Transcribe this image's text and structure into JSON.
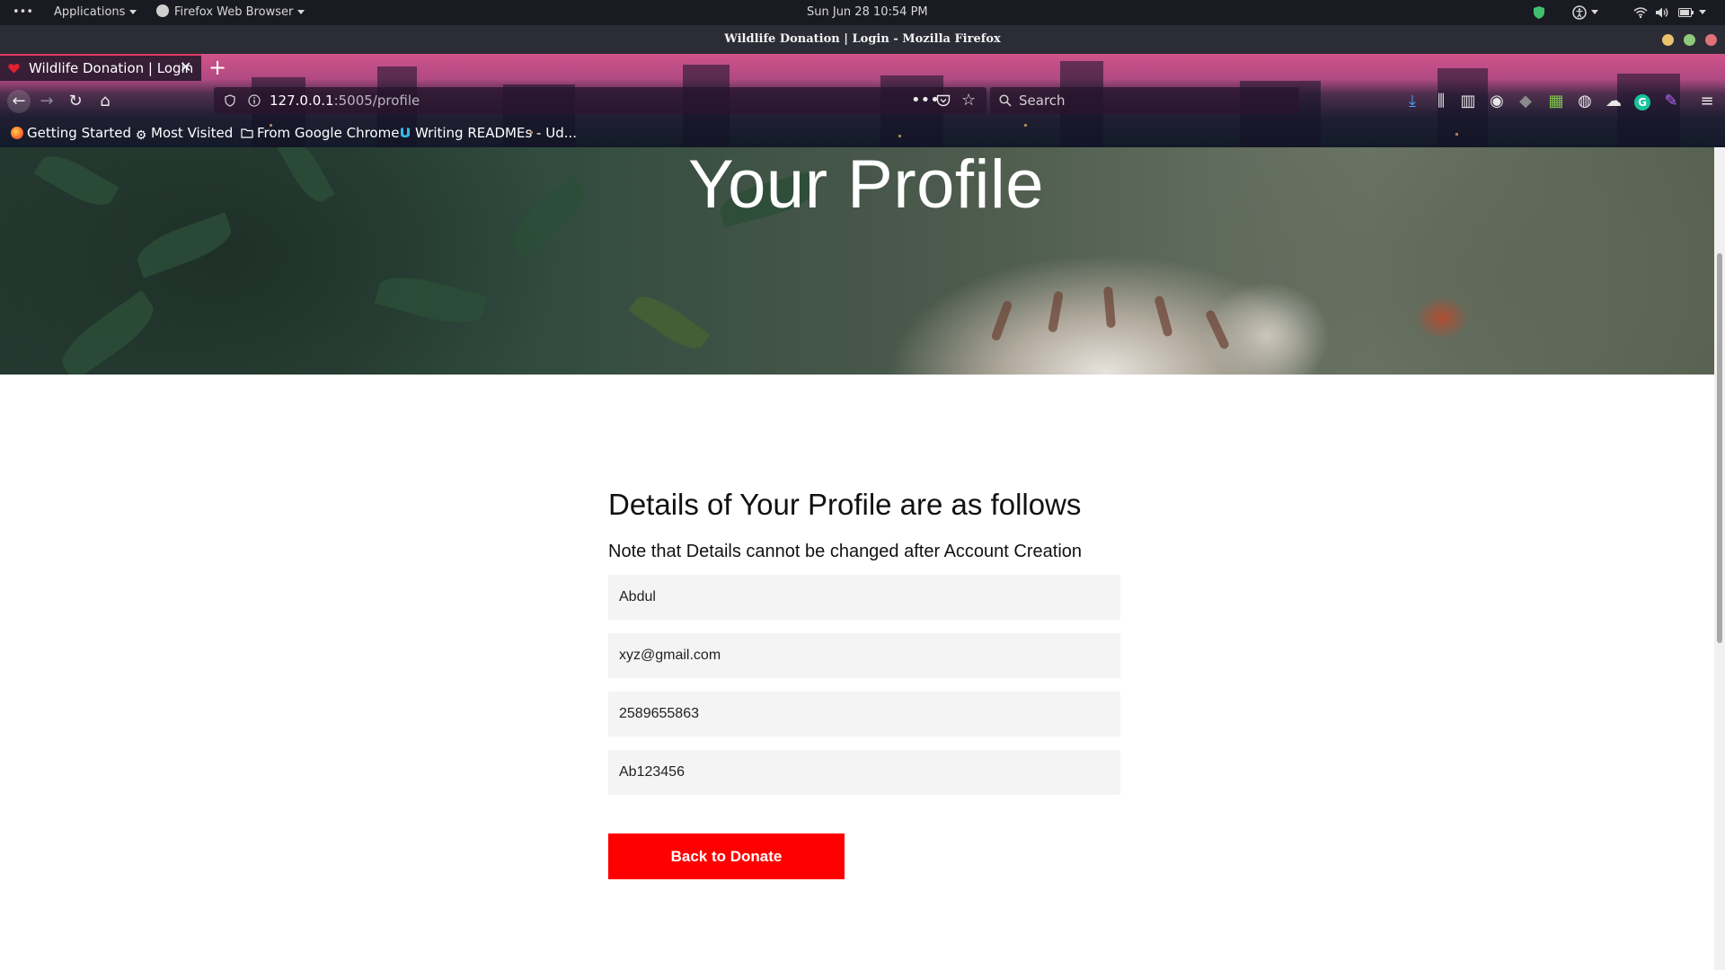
{
  "system_bar": {
    "dots": "•••",
    "applications": "Applications",
    "app_name": "Firefox Web Browser",
    "clock": "Sun Jun 28  10:54 PM"
  },
  "window": {
    "title": "Wildlife Donation | Login - Mozilla Firefox"
  },
  "tabs": [
    {
      "label": "Wildlife Donation | Login",
      "active": true
    }
  ],
  "navbar": {
    "url_host": "127.0.0.1",
    "url_rest": ":5005/profile",
    "search_placeholder": "Search"
  },
  "bookmarks": [
    {
      "label": "Getting Started",
      "icon": "firefox-icon"
    },
    {
      "label": "Most Visited",
      "icon": "gear-icon"
    },
    {
      "label": "From Google Chrome",
      "icon": "folder-icon"
    },
    {
      "label": "Writing READMEs - Ud...",
      "icon": "udacity-icon"
    }
  ],
  "hero": {
    "title": "Your Profile"
  },
  "profile": {
    "heading": "Details of Your Profile are as follows",
    "note": "Note that Details cannot be changed after Account Creation",
    "fields": [
      {
        "name": "name",
        "value": "Abdul"
      },
      {
        "name": "email",
        "value": "xyz@gmail.com"
      },
      {
        "name": "phone",
        "value": "2589655863"
      },
      {
        "name": "password",
        "value": "Ab123456"
      }
    ],
    "back_button": "Back to Donate"
  },
  "colors": {
    "accent": "#ff0000",
    "field_bg": "#f4f4f4",
    "tab_accent": "#e03a66"
  }
}
